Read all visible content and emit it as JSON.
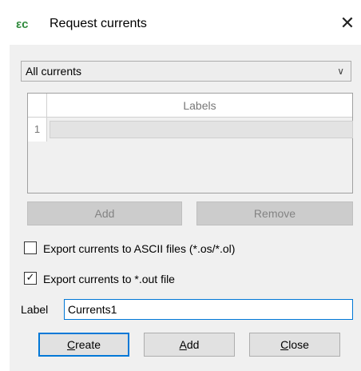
{
  "window": {
    "title": "Request currents",
    "app_icon_glyph": "εc",
    "close_glyph": "✕"
  },
  "combo": {
    "selected": "All currents",
    "arrow_glyph": "∨"
  },
  "table": {
    "header": "Labels",
    "rows": [
      {
        "num": "1",
        "value": ""
      }
    ]
  },
  "table_buttons": {
    "add": "Add",
    "remove": "Remove"
  },
  "options": {
    "export_ascii": {
      "label": "Export currents to ASCII files (*.os/*.ol)",
      "checked": false
    },
    "export_out": {
      "label": "Export currents to *.out file",
      "checked": true
    }
  },
  "label_field": {
    "caption": "Label",
    "value": "Currents1"
  },
  "footer": {
    "create_first": "C",
    "create_rest": "reate",
    "add_first": "A",
    "add_rest": "dd",
    "close_first": "C",
    "close_rest": "lose"
  },
  "colors": {
    "accent": "#0078d7",
    "dialog_bg": "#f0f0f0",
    "app_icon": "#2f8a3c"
  }
}
